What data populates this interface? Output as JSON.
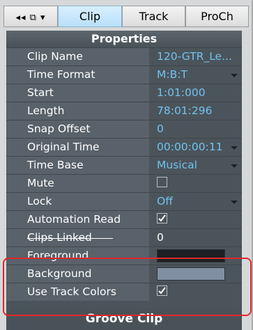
{
  "tabs": {
    "controls_label": "◂◂ ⧉ ▾",
    "items": [
      {
        "label": "Clip",
        "active": true
      },
      {
        "label": "Track",
        "active": false
      },
      {
        "label": "ProCh",
        "active": false
      }
    ]
  },
  "properties": {
    "title": "Properties",
    "rows": [
      {
        "label": "Clip Name",
        "value": "120-GTR_Le..."
      },
      {
        "label": "Time Format",
        "value": "M:B:T",
        "dropdown": true
      },
      {
        "label": "Start",
        "value": "1:01:000"
      },
      {
        "label": "Length",
        "value": "78:01:296"
      },
      {
        "label": "Snap Offset",
        "value": "0"
      },
      {
        "label": "Original Time",
        "value": "00:00:00:11",
        "dropdown": true
      },
      {
        "label": "Time Base",
        "value": "Musical",
        "dropdown": true
      },
      {
        "label": "Mute",
        "checkbox": false
      },
      {
        "label": "Lock",
        "value": "Off",
        "dropdown": true
      },
      {
        "label": "Automation Read",
        "checkbox": true
      },
      {
        "label": "Clips Linked",
        "value": "0"
      },
      {
        "label": "Foreground",
        "color": "#1c2024"
      },
      {
        "label": "Background",
        "color": "#8090a2"
      },
      {
        "label": "Use Track Colors",
        "checkbox": true
      }
    ]
  },
  "footer_label": "Groove Clip",
  "colors": {
    "accent_text": "#6fc3ee",
    "highlight_box": "#e4262a",
    "active_tab": "#c6e6fb"
  }
}
